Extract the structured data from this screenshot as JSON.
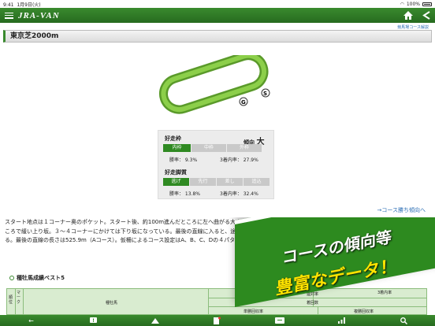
{
  "status": {
    "time": "9:41",
    "date": "1月9日(火)",
    "battery": "100%"
  },
  "nav": {
    "logo": "JRA-VAN"
  },
  "subtitle": "競馬場コース解説",
  "course": {
    "title": "東京芝2000m",
    "start_label": "S",
    "goal_label": "G"
  },
  "panel": {
    "waku_title": "好走枠",
    "trend_label": "傾向",
    "trend_value": "大",
    "waku_opts": [
      "内枠",
      "中枠",
      "外枠"
    ],
    "waku_win": "勝率： 9.3%",
    "waku_top3": "3着内率： 27.9%",
    "kyaku_title": "好走脚質",
    "kyaku_opts": [
      "逃げ",
      "先行",
      "差し",
      "追込"
    ],
    "kyaku_win": "勝率： 13.8%",
    "kyaku_top3": "3着内率： 32.4%"
  },
  "link": "→コース勝ち傾向へ",
  "description": "スタート地点は１コーナー奥のポケット。スタート後、約100m進んだところに左へ曲がる大きなカーブがある。向正面の長い直線を走り、３コーナー手前にさしかかるところで緩い上り坂。３〜４コーナーにかけては下り坂になっている。最後の直線に入ると、途中になだらかな上り坂（高低差2.1m）。東京競馬場全体の高低差は2.7mある。最後の直線の長さは525.9m（Aコース）。仮柵によるコース設定はA、B、C、Dの４パターン。３mごとに幅員が異なる。護している。",
  "best": {
    "title": "種牡馬成績ベスト5"
  },
  "table": {
    "h_rank": "順位",
    "h_mark": "マーク",
    "h_sire": "種牡馬",
    "h_win": "勝率",
    "h_ren": "連対率",
    "h_top3": "3着内率",
    "h_count": "着回数",
    "h_tansho": "単勝回収率",
    "h_fukusho": "複勝回収率"
  },
  "promo": {
    "line1": "コースの傾向等",
    "line2": "豊富なデータ！"
  },
  "colors": {
    "brand": "#2f8a22",
    "link": "#2d6fb5",
    "promo_text": "#ffe300"
  }
}
